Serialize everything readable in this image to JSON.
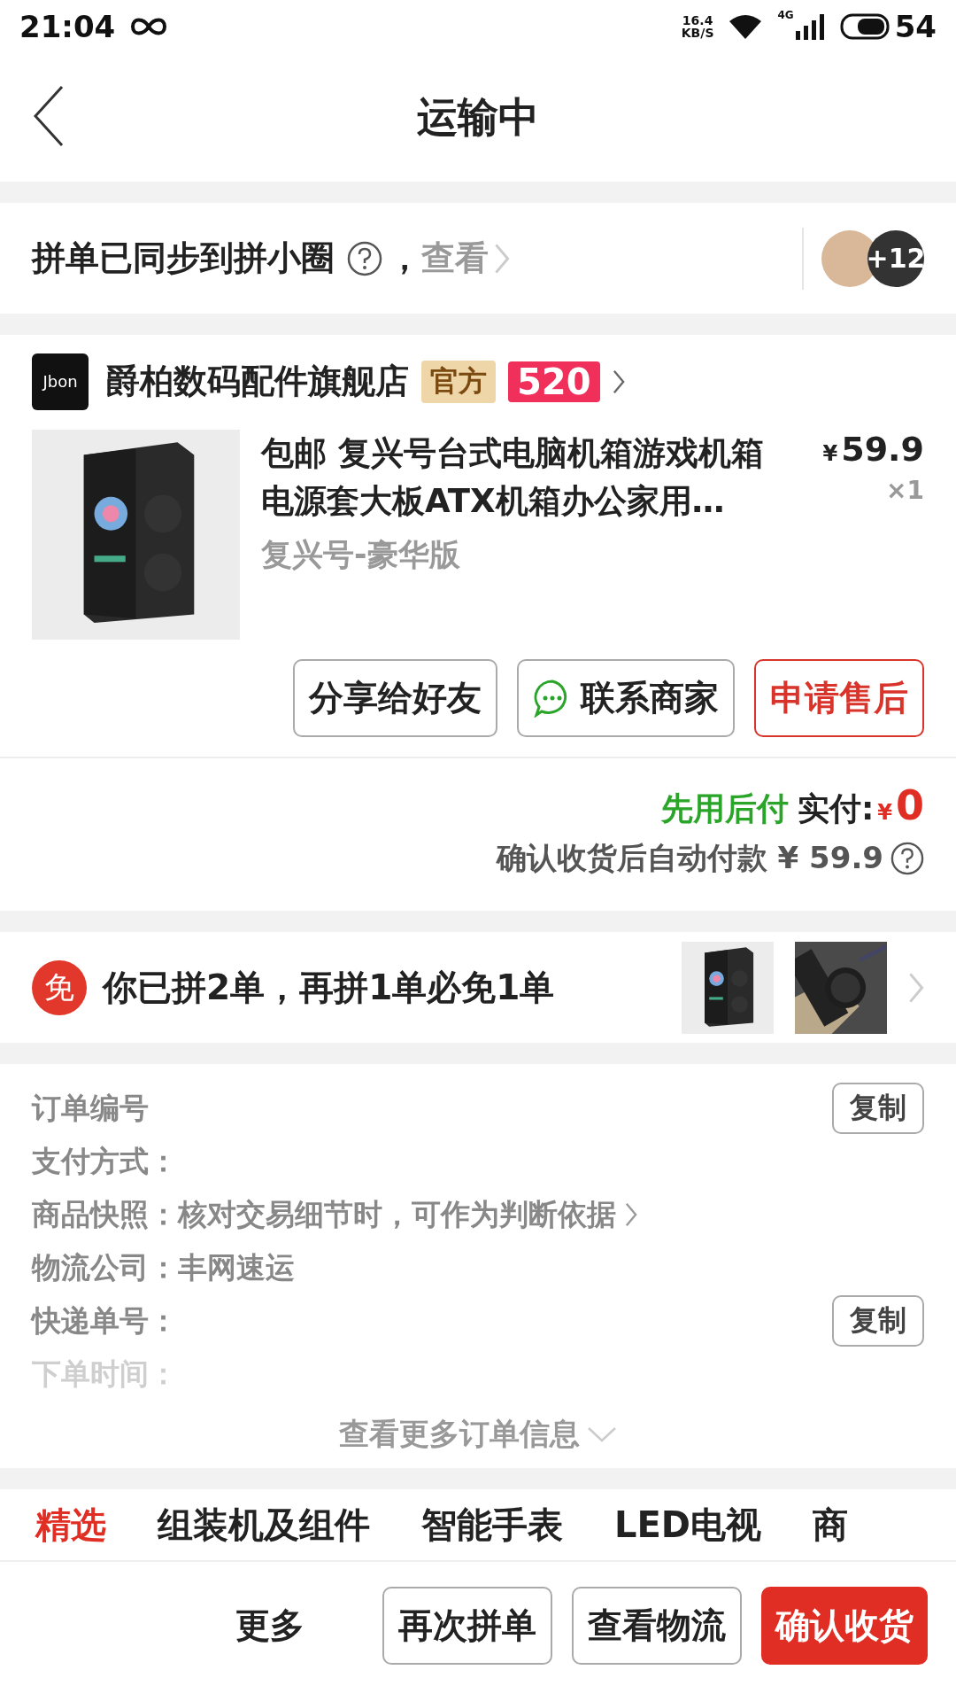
{
  "status_bar": {
    "time": "21:04",
    "speed_value": "16.4",
    "speed_unit": "KB/S",
    "network": "4G",
    "battery": "54"
  },
  "header": {
    "title": "运输中"
  },
  "group_sync": {
    "text": "拼单已同步到拼小圈",
    "comma": "，",
    "link": "查看",
    "avatar_count": "+12"
  },
  "store": {
    "logo": "Jbon",
    "name": "爵柏数码配件旗舰店",
    "badges": [
      {
        "text": "官方",
        "kind": "official"
      },
      {
        "text": "520",
        "kind": "promo"
      }
    ]
  },
  "product": {
    "title": "包邮 复兴号台式电脑机箱游戏机箱电源套大板ATX机箱办公家用…",
    "variant": "复兴号-豪华版",
    "currency": "¥",
    "price": "59.9",
    "quantity": "×1"
  },
  "product_actions": [
    {
      "label": "分享给好友",
      "kind": "plain"
    },
    {
      "label": "联系商家",
      "kind": "chat"
    },
    {
      "label": "申请售后",
      "kind": "accent"
    }
  ],
  "payment": {
    "plan": "先用后付",
    "paid_label": "实付:",
    "currency": "¥",
    "paid": "0",
    "note": "确认收货后自动付款 ¥ 59.9"
  },
  "promo": {
    "icon_text": "免",
    "text": "你已拼2单，再拼1单必免1单"
  },
  "order_info": {
    "rows": [
      {
        "label": "订单编号",
        "copy": "复制"
      },
      {
        "label": "支付方式："
      },
      {
        "label": "商品快照：",
        "value": "核对交易细节时，可作为判断依据",
        "link": true
      },
      {
        "label": "物流公司：",
        "value": "丰网速运"
      },
      {
        "label": "快递单号：",
        "copy": "复制"
      },
      {
        "label": "下单时间：",
        "faded": true
      }
    ],
    "more": "查看更多订单信息"
  },
  "category_tabs": [
    {
      "label": "精选",
      "selected": true
    },
    {
      "label": "组装机及组件",
      "selected": false
    },
    {
      "label": "智能手表",
      "selected": false
    },
    {
      "label": "LED电视",
      "selected": false
    },
    {
      "label": "商",
      "selected": false
    }
  ],
  "bottom_actions": [
    {
      "label": "更多",
      "kind": "text"
    },
    {
      "label": "再次拼单",
      "kind": "outline"
    },
    {
      "label": "查看物流",
      "kind": "outline"
    },
    {
      "label": "确认收货",
      "kind": "primary"
    }
  ]
}
